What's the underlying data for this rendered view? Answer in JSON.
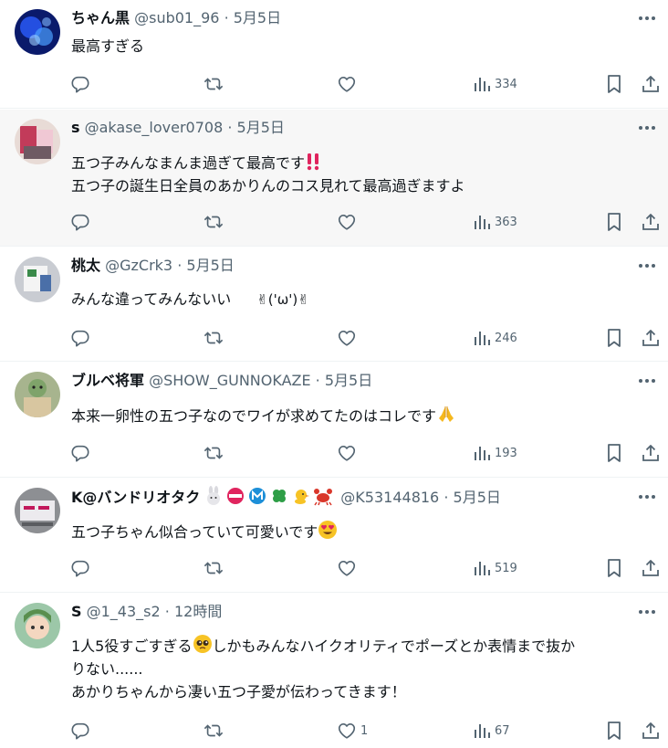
{
  "tweets": [
    {
      "name": "ちゃん黒",
      "handle": "@sub01_96",
      "sep": "·",
      "time": "5月5日",
      "lines": [
        "最高すぎる"
      ],
      "likes": "",
      "views": "334",
      "highlighted": false
    },
    {
      "name": "s",
      "handle": "@akase_lover0708",
      "sep": "·",
      "time": "5月5日",
      "lines": [
        "五つ子みんなまんま過ぎて最高です",
        "五つ子の誕生日全員のあかりんのコス見れて最高過ぎますよ"
      ],
      "likes": "",
      "views": "363",
      "highlighted": true
    },
    {
      "name": "桃太",
      "handle": "@GzCrk3",
      "sep": "·",
      "time": "5月5日",
      "lines": [
        "みんな違ってみんないい　",
        "✌('ω')✌"
      ],
      "likes": "",
      "views": "246",
      "highlighted": false
    },
    {
      "name": "ブルベ将軍",
      "handle": "@SHOW_GUNNOKAZE",
      "sep": "·",
      "time": "5月5日",
      "lines": [
        "本来一卵性の五つ子なのでワイが求めてたのはコレです"
      ],
      "likes": "",
      "views": "193",
      "highlighted": false
    },
    {
      "name": "K@バンドリオタク",
      "handle": "@K53144816",
      "sep": "·",
      "time": "5月5日",
      "lines": [
        "五つ子ちゃん似合っていて可愛いです"
      ],
      "likes": "",
      "views": "519",
      "highlighted": false
    },
    {
      "name": "S",
      "handle": "@1_43_s2",
      "sep": "·",
      "time": "12時間",
      "lines": [
        "1人5役すごすぎる",
        "しかもみんなハイクオリティでポーズとか表情まで抜か",
        "りない......",
        "あかりちゃんから凄い五つ子愛が伝わってきます！"
      ],
      "likes": "1",
      "views": "67",
      "highlighted": false
    }
  ],
  "icons": [
    "reply-icon",
    "retweet-icon",
    "like-icon",
    "views-icon",
    "bookmark-icon",
    "share-icon",
    "more-icon"
  ],
  "colors": {
    "text": "#0f1419",
    "secondary": "#536471",
    "highlight_bg": "#f7f7f7",
    "divider": "#eff3f4"
  }
}
